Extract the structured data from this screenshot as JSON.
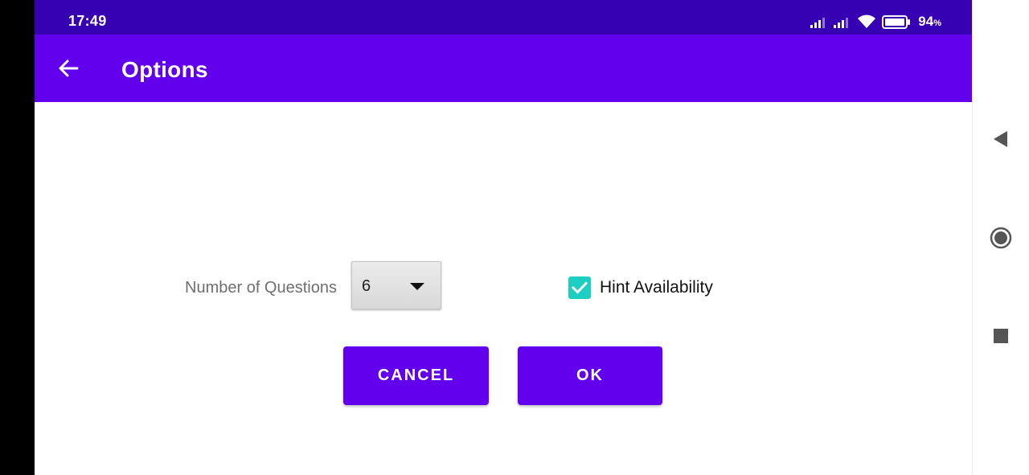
{
  "status_bar": {
    "time": "17:49",
    "battery_percent": "94",
    "battery_unit": "%",
    "icons": [
      "signal-icon",
      "signal-icon",
      "wifi-icon",
      "battery-icon"
    ]
  },
  "app_bar": {
    "title": "Options",
    "back_icon": "arrow-left-icon"
  },
  "options": {
    "questions_label": "Number of Questions",
    "questions_value": "6",
    "hint_label": "Hint Availability",
    "hint_checked": true
  },
  "buttons": {
    "cancel_label": "CANCEL",
    "ok_label": "OK"
  },
  "nav_bar": {
    "icons": [
      "back-triangle-icon",
      "home-circle-icon",
      "recents-square-icon"
    ]
  },
  "colors": {
    "status_bar": "#3700b3",
    "primary": "#6200ee",
    "checkbox": "#1ccfc0",
    "nav_icon": "#555555"
  }
}
